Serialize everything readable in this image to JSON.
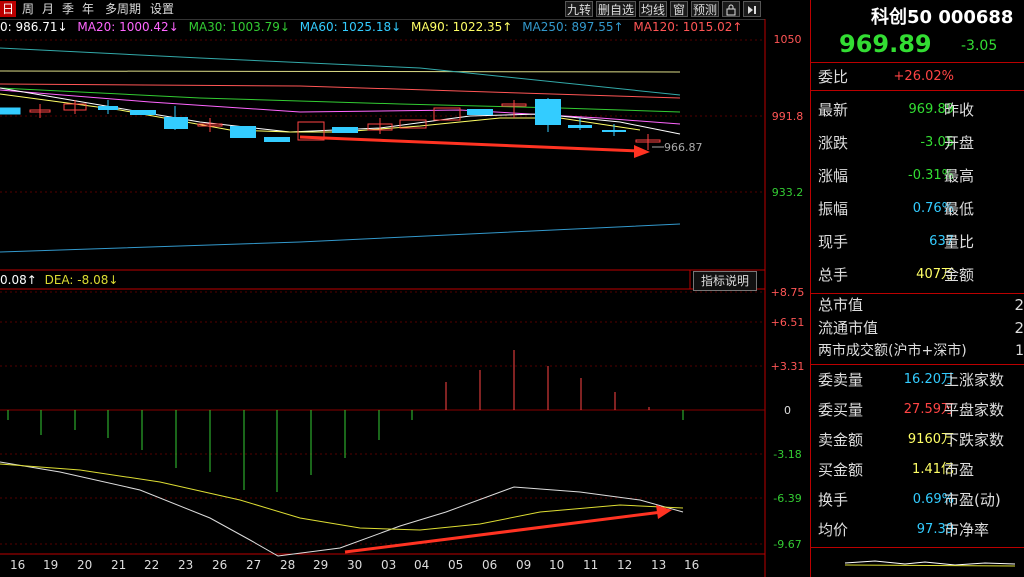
{
  "toolbar": {
    "periods": [
      "日",
      "周",
      "月",
      "季",
      "年",
      "多周期",
      "设置"
    ],
    "active_period": "日",
    "tools": [
      "九转",
      "删自选",
      "均线",
      "窗",
      "预测"
    ],
    "lock_icon": "lock-icon",
    "collapse_icon": "collapse-right-icon"
  },
  "ma_line": {
    "ma10": "0: 986.71↓",
    "ma20": "MA20: 1000.42↓",
    "ma30": "MA30: 1003.79↓",
    "ma60": "MA60: 1025.18↓",
    "ma90": "MA90: 1022.35↑",
    "ma250": "MA250: 897.55↑",
    "ma120": "MA120: 1015.02↑",
    "colors": {
      "ma10": "#ffffff",
      "ma20": "#ff66ff",
      "ma30": "#33cc33",
      "ma60": "#33ccff",
      "ma90": "#ffff66",
      "ma250": "#3399cc",
      "ma120": "#ff5555"
    }
  },
  "price_axis": [
    "1050",
    "991.8",
    "933.2"
  ],
  "last_price_label": "966.87",
  "macd_line": {
    "diff": "0.08↑",
    "dea": "DEA: -8.08↓"
  },
  "indicator_button": "指标说明",
  "macd_axis": [
    "+8.75",
    "+6.51",
    "+3.31",
    "0",
    "-3.18",
    "-6.39",
    "-9.67"
  ],
  "dates": [
    "16",
    "19",
    "20",
    "21",
    "22",
    "23",
    "26",
    "27",
    "28",
    "29",
    "30",
    "03",
    "04",
    "05",
    "06",
    "09",
    "10",
    "11",
    "12",
    "13",
    "16"
  ],
  "quote": {
    "name": "科创50 000688",
    "price": "969.89",
    "change": "-3.05",
    "rows": [
      {
        "l": "委比",
        "v": "+26.02%",
        "r": "",
        "vc": "#ff4444"
      },
      {
        "l": "最新",
        "v": "969.89",
        "r": "昨收",
        "vc": "#33dd33"
      },
      {
        "l": "涨跌",
        "v": "-3.05",
        "r": "开盘",
        "vc": "#33dd33"
      },
      {
        "l": "涨幅",
        "v": "-0.31%",
        "r": "最高",
        "vc": "#33dd33"
      },
      {
        "l": "振幅",
        "v": "0.76%",
        "r": "最低",
        "vc": "#33ccff"
      },
      {
        "l": "现手",
        "v": "637",
        "r": "量比",
        "vc": "#33ccff"
      },
      {
        "l": "总手",
        "v": "407万",
        "r": "金额",
        "vc": "#ffff66"
      }
    ],
    "market": [
      {
        "l": "总市值",
        "v": "2"
      },
      {
        "l": "流通市值",
        "v": "2"
      },
      {
        "l": "两市成交额(沪市+深市)",
        "v": "1"
      }
    ],
    "orders": [
      {
        "l": "委卖量",
        "v": "16.20万",
        "r": "上涨家数",
        "vc": "#33ccff"
      },
      {
        "l": "委买量",
        "v": "27.59万",
        "r": "平盘家数",
        "vc": "#ff4444"
      },
      {
        "l": "卖金额",
        "v": "9160万",
        "r": "下跌家数",
        "vc": "#ffff66"
      },
      {
        "l": "买金额",
        "v": "1.41亿",
        "r": "市盈",
        "vc": "#ffff66"
      },
      {
        "l": "换手",
        "v": "0.69%",
        "r": "市盈(动)",
        "vc": "#33ccff"
      },
      {
        "l": "均价",
        "v": "97.39",
        "r": "市净率",
        "vc": "#33ccff"
      }
    ]
  }
}
